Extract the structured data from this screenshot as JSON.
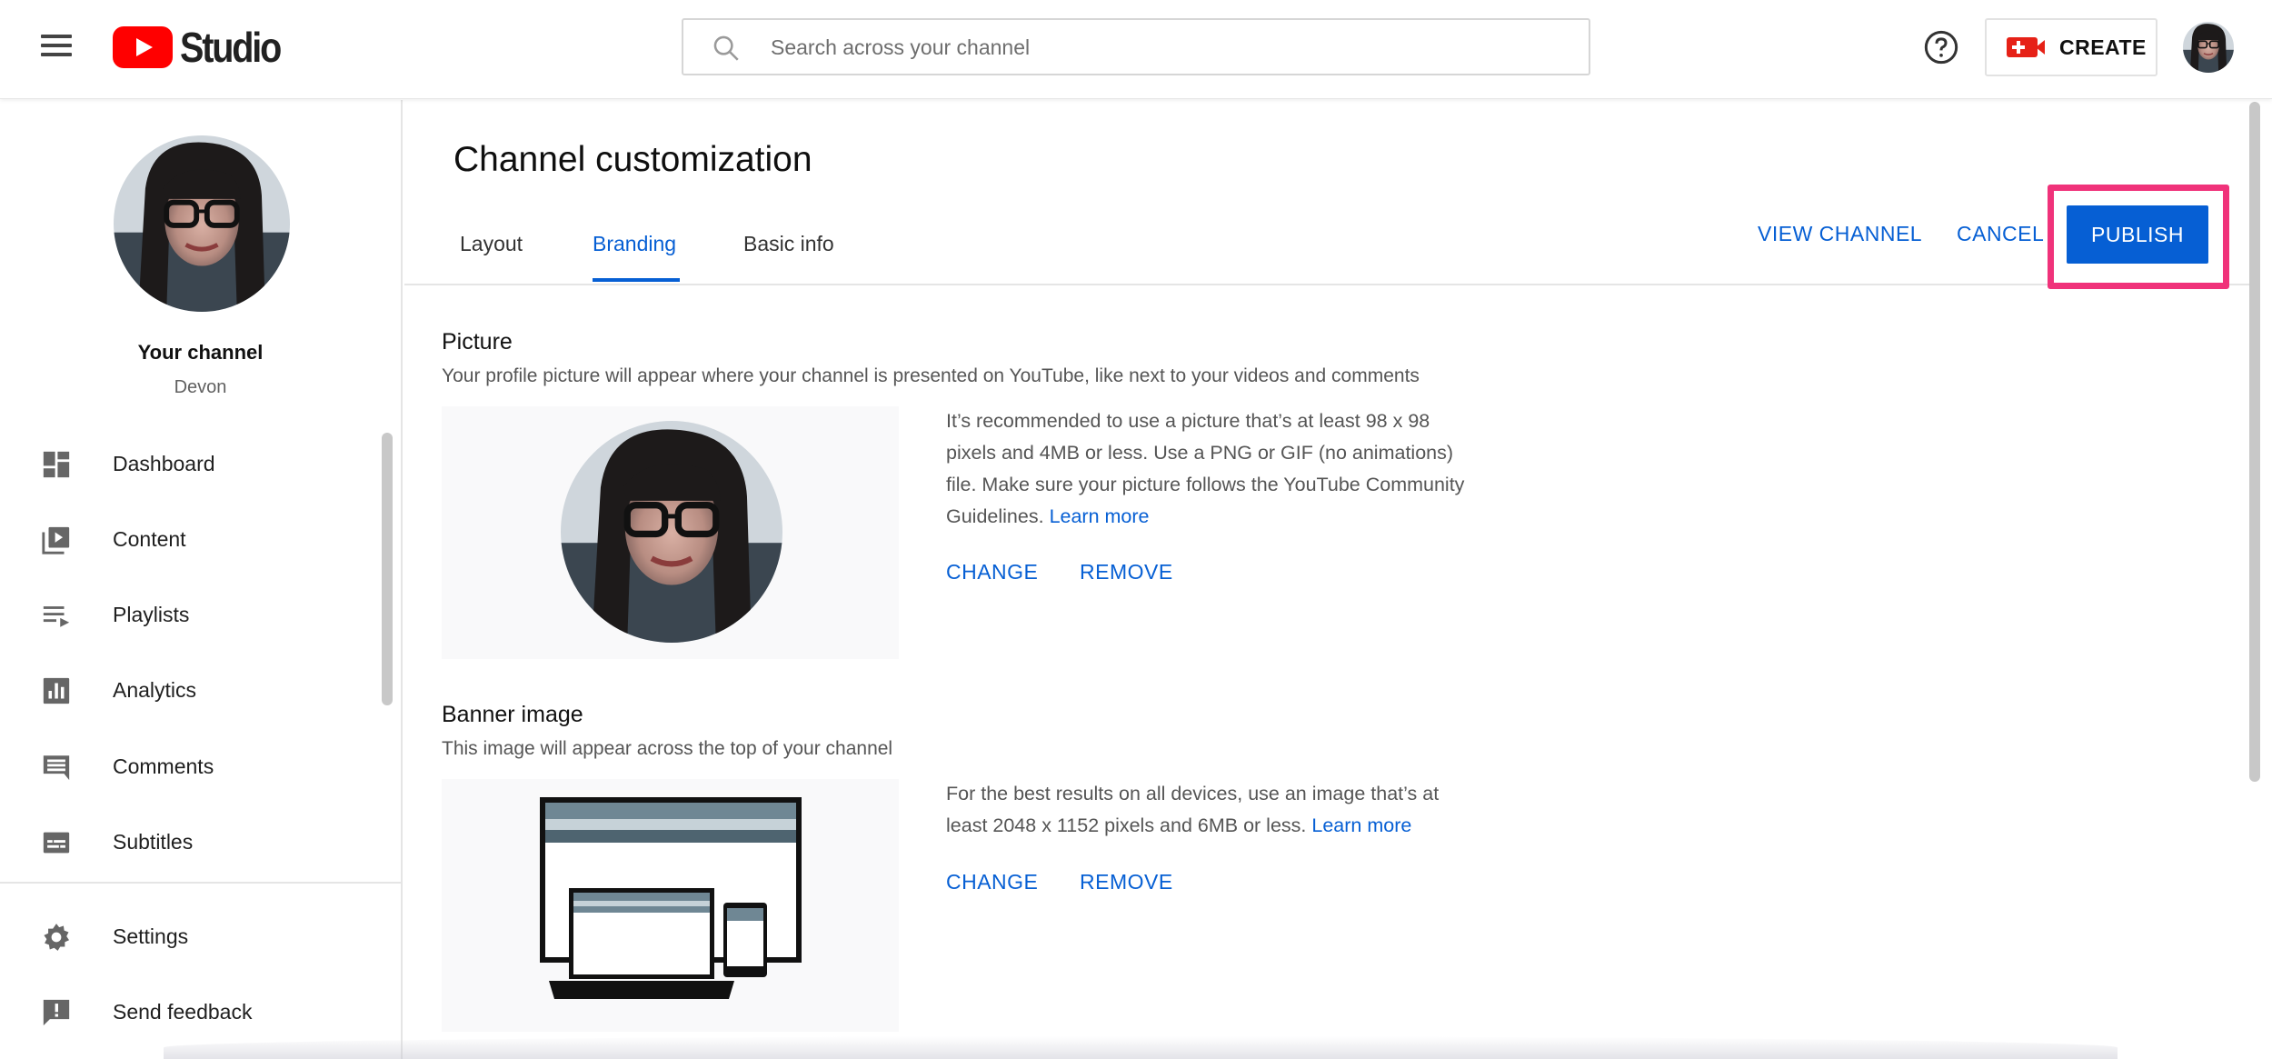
{
  "header": {
    "logo_text": "Studio",
    "search_placeholder": "Search across your channel",
    "create_label": "CREATE"
  },
  "sidebar": {
    "your_channel_label": "Your channel",
    "channel_name": "Devon",
    "items": [
      {
        "label": "Dashboard",
        "icon": "dashboard-icon"
      },
      {
        "label": "Content",
        "icon": "content-icon"
      },
      {
        "label": "Playlists",
        "icon": "playlists-icon"
      },
      {
        "label": "Analytics",
        "icon": "analytics-icon"
      },
      {
        "label": "Comments",
        "icon": "comments-icon"
      },
      {
        "label": "Subtitles",
        "icon": "subtitles-icon"
      }
    ],
    "footer_items": [
      {
        "label": "Settings",
        "icon": "gear-icon"
      },
      {
        "label": "Send feedback",
        "icon": "feedback-icon"
      }
    ]
  },
  "main": {
    "title": "Channel customization",
    "tabs": [
      {
        "label": "Layout"
      },
      {
        "label": "Branding",
        "active": true
      },
      {
        "label": "Basic info"
      }
    ],
    "actions": {
      "view_channel": "VIEW CHANNEL",
      "cancel": "CANCEL",
      "publish": "PUBLISH"
    },
    "picture": {
      "title": "Picture",
      "description": "Your profile picture will appear where your channel is presented on YouTube, like next to your videos and comments",
      "info": "It’s recommended to use a picture that’s at least 98 x 98 pixels and 4MB or less. Use a PNG or GIF (no animations) file. Make sure your picture follows the YouTube Community Guidelines.",
      "learn_more": "Learn more",
      "change": "CHANGE",
      "remove": "REMOVE"
    },
    "banner": {
      "title": "Banner image",
      "description": "This image will appear across the top of your channel",
      "info": "For the best results on all devices, use an image that’s at least 2048 x 1152 pixels and 6MB or less.",
      "learn_more": "Learn more",
      "change": "CHANGE",
      "remove": "REMOVE"
    }
  },
  "colors": {
    "accent": "#065fd4",
    "highlight": "#f0327a",
    "youtube_red": "#ff0000"
  }
}
